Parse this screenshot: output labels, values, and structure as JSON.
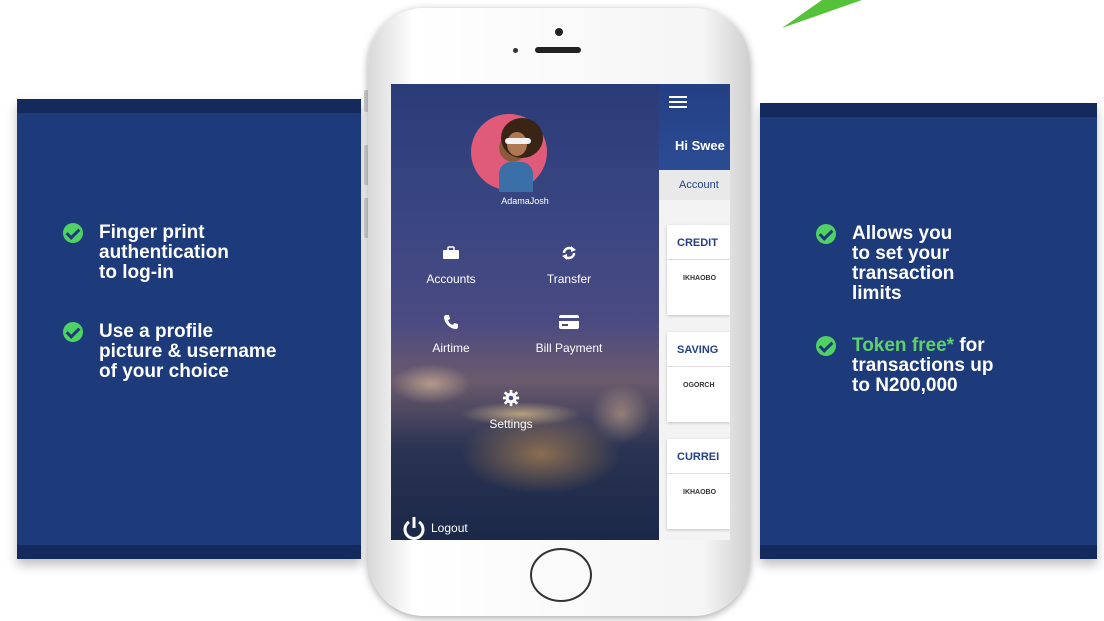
{
  "left_panel": {
    "features": [
      {
        "lines": [
          "Finger print",
          "authentication",
          "to log-in"
        ]
      },
      {
        "lines": [
          "Use a profile",
          "picture & username",
          "of your choice"
        ]
      }
    ]
  },
  "right_panel": {
    "features": [
      {
        "lines": [
          "Allows you",
          "to set your",
          "transaction",
          "limits"
        ]
      },
      {
        "highlight": "Token free*",
        "after": " for",
        "lines": [
          "transactions up",
          "to N200,000"
        ]
      }
    ]
  },
  "app": {
    "username": "AdamaJosh",
    "menu": {
      "accounts": "Accounts",
      "transfer": "Transfer",
      "airtime": "Airtime",
      "bill_payment": "Bill Payment",
      "settings": "Settings"
    },
    "logout": "Logout",
    "greeting": "Hi Swee",
    "tab": "Account",
    "cards": [
      {
        "title": "CREDIT",
        "name": "IKHAOBO"
      },
      {
        "title": "SAVING",
        "name": "OGORCH"
      },
      {
        "title": "CURREI",
        "name": "IKHAOBO"
      }
    ]
  },
  "colors": {
    "panel": "#1d3a7a",
    "check": "#4ed264",
    "highlight": "#5fd16a",
    "app_header": "#243f84"
  },
  "icons": [
    "check-circle-icon",
    "briefcase-icon",
    "transfer-arrows-icon",
    "phone-icon",
    "credit-card-icon",
    "gear-icon",
    "power-icon",
    "hamburger-icon"
  ]
}
